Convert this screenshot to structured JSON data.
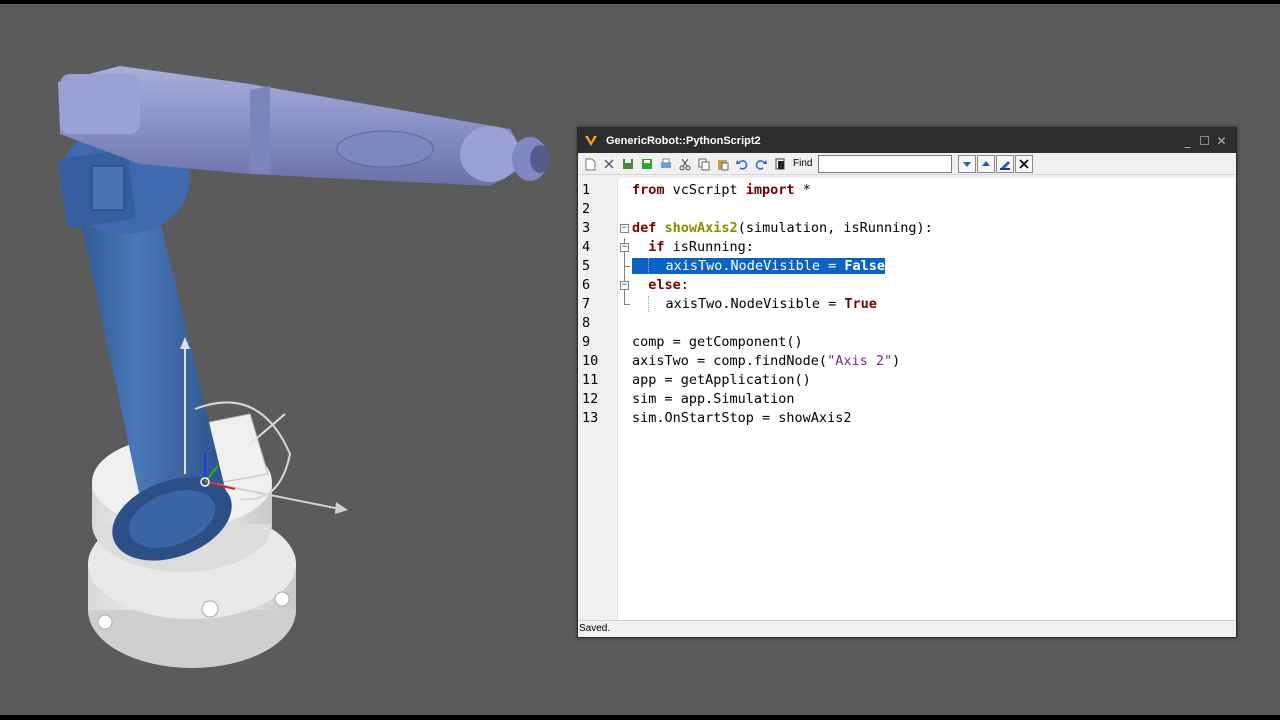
{
  "window": {
    "title": "GenericRobot::PythonScript2",
    "controls": [
      "_",
      "☐",
      "✕"
    ]
  },
  "toolbar": {
    "find_label": "Find",
    "find_value": "",
    "icons": [
      "new-icon",
      "cut-script-icon",
      "save-icon",
      "save-green-icon",
      "print-icon",
      "cut-icon",
      "copy-icon",
      "paste-icon",
      "undo-icon",
      "redo-icon",
      "document-icon"
    ],
    "find_buttons": [
      "find-next-icon",
      "find-previous-icon",
      "highlight-icon",
      "close-find-icon"
    ]
  },
  "code": {
    "line_numbers": [
      "1",
      "2",
      "3",
      "4",
      "5",
      "6",
      "7",
      "8",
      "9",
      "10",
      "11",
      "12",
      "13"
    ],
    "selected_line": 5
  },
  "status": {
    "text": "Saved."
  },
  "colors": {
    "viewport_bg": "#5b5b5b",
    "robot_blue": "#3e69a8",
    "robot_lavender": "#8a93c9",
    "selection": "#0a64c8",
    "keyword": "#7a0000",
    "function_name": "#8b8b00",
    "string": "#7a2aa0"
  }
}
